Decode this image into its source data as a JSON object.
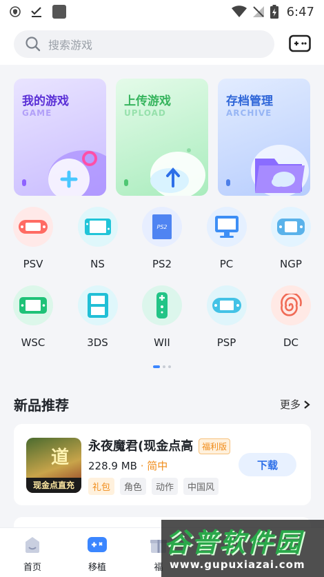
{
  "status_bar": {
    "time": "6:47"
  },
  "search": {
    "placeholder": "搜索游戏"
  },
  "feature_cards": [
    {
      "title": "我的游戏",
      "subtitle": "GAME"
    },
    {
      "title": "上传游戏",
      "subtitle": "UPLOAD"
    },
    {
      "title": "存档管理",
      "subtitle": "ARCHIVE"
    }
  ],
  "platforms": [
    {
      "label": "PSV"
    },
    {
      "label": "NS"
    },
    {
      "label": "PS2",
      "icon_text": "PS2"
    },
    {
      "label": "PC"
    },
    {
      "label": "NGP"
    },
    {
      "label": "WSC"
    },
    {
      "label": "3DS"
    },
    {
      "label": "WII"
    },
    {
      "label": "PSP"
    },
    {
      "label": "DC"
    }
  ],
  "section": {
    "title": "新品推荐",
    "more": "更多"
  },
  "game": {
    "name": "永夜魔君(现金点高",
    "badge": "福利版",
    "size": "228.9 MB",
    "separator": " · ",
    "language": "简中",
    "tags": [
      "礼包",
      "角色",
      "动作",
      "中国风"
    ],
    "download": "下载",
    "thumb_char": "道",
    "thumb_strip": "现金点直充"
  },
  "bottom_nav": [
    {
      "label": "首页"
    },
    {
      "label": "移植"
    },
    {
      "label": "福"
    }
  ],
  "watermark": {
    "title": "谷普软件园",
    "url": "www.gupuxiazai.com"
  },
  "colors": {
    "accent": "#3b86ff",
    "orange": "#f08c1a"
  }
}
